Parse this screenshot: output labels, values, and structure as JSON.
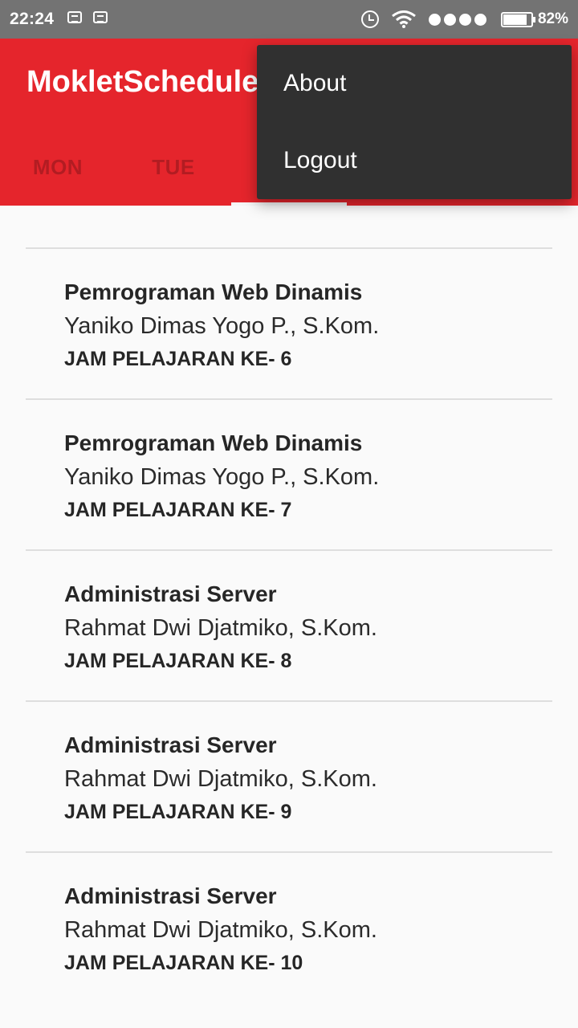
{
  "status_bar": {
    "time": "22:24",
    "battery_percent": "82%",
    "battery_level": 0.82,
    "signal_bars": 4,
    "icons": [
      "bbm-icon",
      "bbm-icon",
      "alarm-icon",
      "wifi-icon",
      "signal-icon",
      "battery-icon"
    ]
  },
  "app_bar": {
    "title": "MokletSchedule",
    "background_color": "#e5252c"
  },
  "tabs": [
    {
      "label": "MON"
    },
    {
      "label": "TUE"
    },
    {
      "label": ""
    },
    {
      "label": ""
    },
    {
      "label": ""
    }
  ],
  "selected_tab_index": 2,
  "overflow_menu": {
    "items": [
      {
        "label": "About"
      },
      {
        "label": "Logout"
      }
    ],
    "background_color": "#303030"
  },
  "schedule": [
    {
      "subject": "Pemrograman Web Dinamis",
      "teacher": "Yaniko Dimas Yogo P., S.Kom.",
      "period": "JAM PELAJARAN KE- 6"
    },
    {
      "subject": "Pemrograman Web Dinamis",
      "teacher": "Yaniko Dimas Yogo P., S.Kom.",
      "period": "JAM PELAJARAN KE- 7"
    },
    {
      "subject": "Administrasi Server",
      "teacher": "Rahmat Dwi Djatmiko, S.Kom.",
      "period": "JAM PELAJARAN KE- 8"
    },
    {
      "subject": "Administrasi Server",
      "teacher": "Rahmat Dwi Djatmiko, S.Kom.",
      "period": "JAM PELAJARAN KE- 9"
    },
    {
      "subject": "Administrasi Server",
      "teacher": "Rahmat Dwi Djatmiko, S.Kom.",
      "period": "JAM PELAJARAN KE- 10"
    }
  ]
}
